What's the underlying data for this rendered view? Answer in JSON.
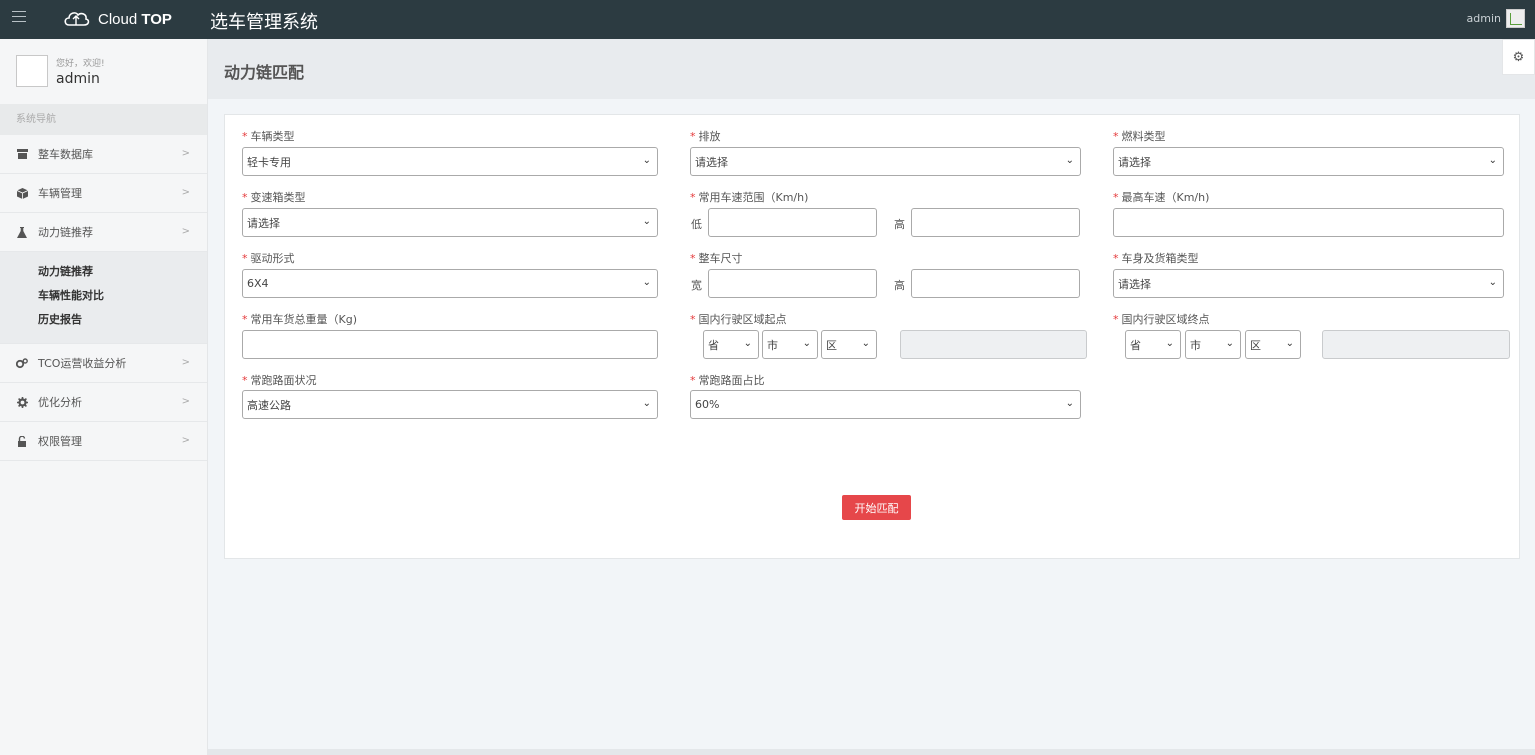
{
  "topbar": {
    "brand_light": "Cloud ",
    "brand_bold": "TOP",
    "system_title": "选车管理系统",
    "username": "admin"
  },
  "sidebar": {
    "greeting": "您好，欢迎!",
    "profile_name": "admin",
    "nav_header": "系统导航",
    "items": [
      {
        "label": "整车数据库",
        "icon": "database-icon"
      },
      {
        "label": "车辆管理",
        "icon": "cube-icon"
      },
      {
        "label": "动力链推荐",
        "icon": "flask-icon"
      },
      {
        "label": "TCO运营收益分析",
        "icon": "cogs-icon"
      },
      {
        "label": "优化分析",
        "icon": "gear-icon"
      },
      {
        "label": "权限管理",
        "icon": "unlock-icon"
      }
    ],
    "submenu": [
      "动力链推荐",
      "车辆性能对比",
      "历史报告"
    ]
  },
  "page": {
    "title": "动力链匹配"
  },
  "form": {
    "vehicle_type": {
      "label": "车辆类型",
      "value": "轻卡专用"
    },
    "emission": {
      "label": "排放",
      "value": "请选择"
    },
    "fuel_type": {
      "label": "燃料类型",
      "value": "请选择"
    },
    "gearbox_type": {
      "label": "变速箱类型",
      "value": "请选择"
    },
    "speed_range": {
      "label": "常用车速范围（Km/h)",
      "low": "低",
      "high": "高"
    },
    "max_speed": {
      "label": "最高车速（Km/h)"
    },
    "drive_form": {
      "label": "驱动形式",
      "value": "6X4"
    },
    "size": {
      "label": "整车尺寸",
      "width": "宽",
      "height": "高"
    },
    "body_type": {
      "label": "车身及货箱类型",
      "value": "请选择"
    },
    "total_weight": {
      "label": "常用车货总重量（Kg)"
    },
    "region_start": {
      "label": "国内行驶区域起点",
      "province": "省",
      "city": "市",
      "district": "区"
    },
    "region_end": {
      "label": "国内行驶区域终点",
      "province": "省",
      "city": "市",
      "district": "区"
    },
    "road_condition": {
      "label": "常跑路面状况",
      "value": "高速公路"
    },
    "road_ratio": {
      "label": "常跑路面占比",
      "value": "60%"
    },
    "submit_label": "开始匹配"
  },
  "colors": {
    "topbar": "#2c3b41",
    "required": "#e5393a",
    "primary_button": "#e6474a"
  }
}
